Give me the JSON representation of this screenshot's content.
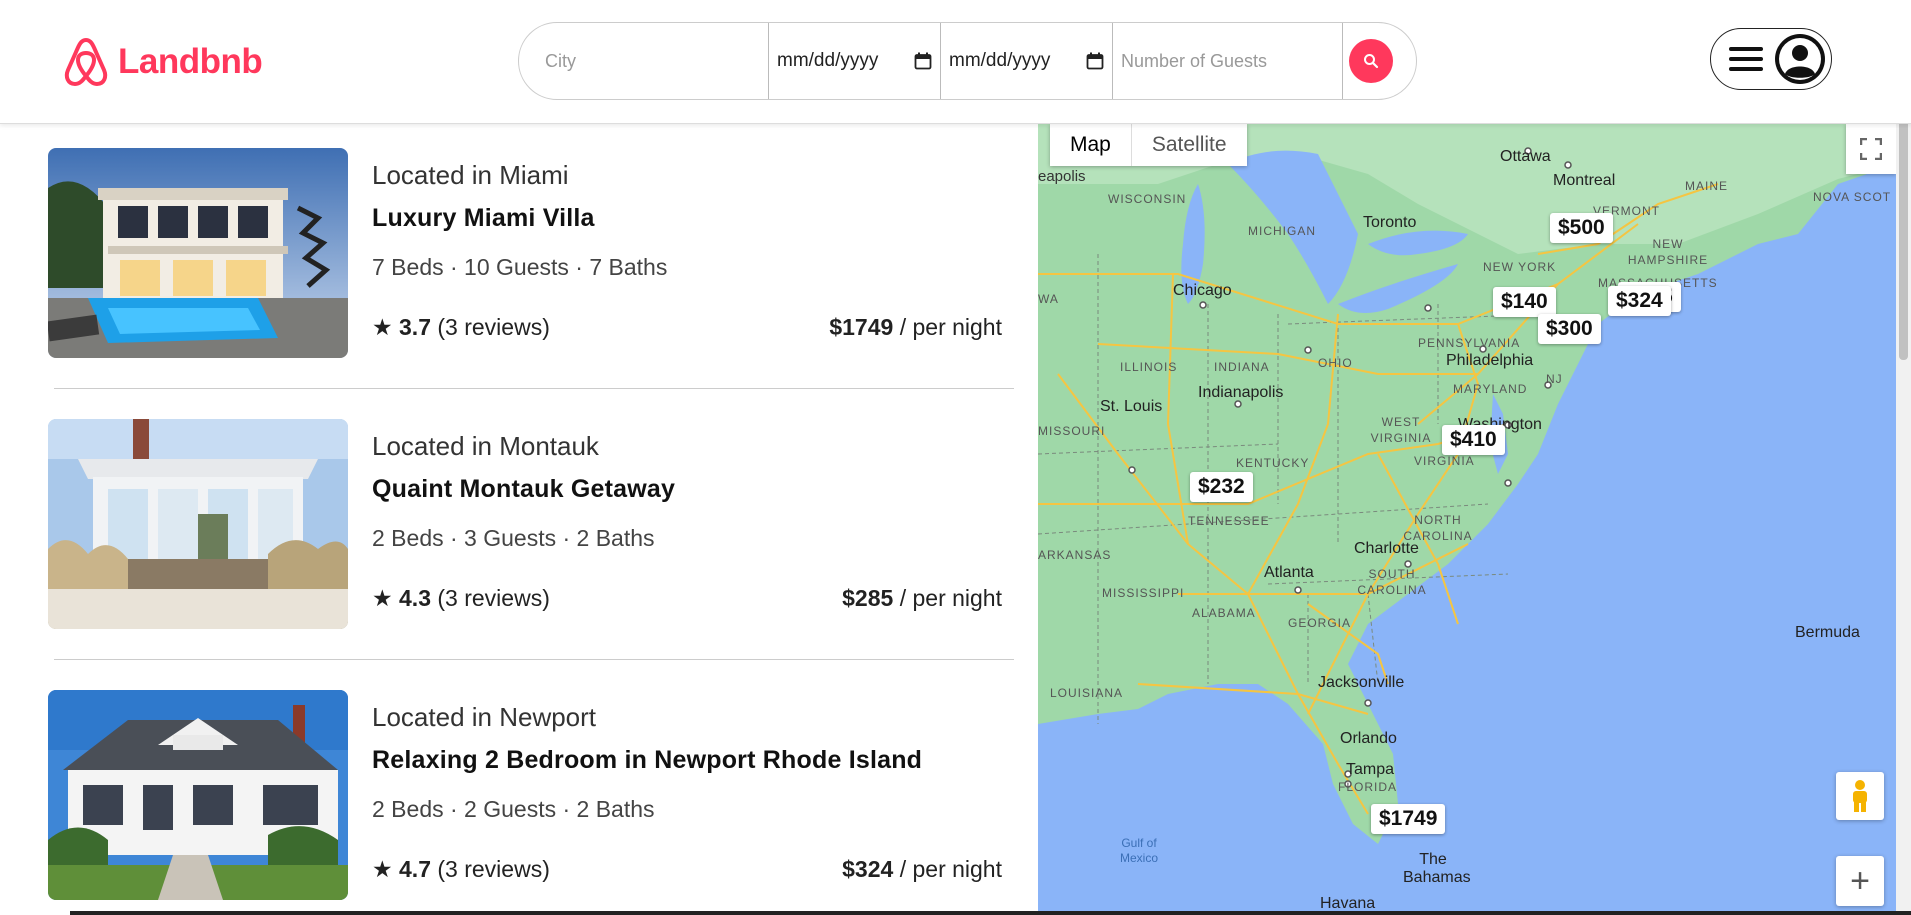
{
  "brand": {
    "name": "Landbnb",
    "color": "#ff385c"
  },
  "search": {
    "city_placeholder": "City",
    "checkin_placeholder": "mm/dd/yyyy",
    "checkout_placeholder": "mm/dd/yyyy",
    "guests_placeholder": "Number of Guests",
    "button_icon": "search-icon"
  },
  "user_menu": {
    "menu_icon": "hamburger-icon",
    "avatar_icon": "user-avatar-icon"
  },
  "listings": [
    {
      "location": "Located in Miami",
      "title": "Luxury Miami Villa",
      "details": "7 Beds · 10 Guests · 7 Baths",
      "rating": "3.7",
      "reviews": "(3 reviews)",
      "price": "$1749",
      "price_suffix": "/ per night"
    },
    {
      "location": "Located in Montauk",
      "title": "Quaint Montauk Getaway",
      "details": "2 Beds · 3 Guests · 2 Baths",
      "rating": "4.3",
      "reviews": "(3 reviews)",
      "price": "$285",
      "price_suffix": "/ per night"
    },
    {
      "location": "Located in Newport",
      "title": "Relaxing 2 Bedroom in Newport Rhode Island",
      "details": "2 Beds · 2 Guests · 2 Baths",
      "rating": "4.7",
      "reviews": "(3 reviews)",
      "price": "$324",
      "price_suffix": "/ per night"
    }
  ],
  "map": {
    "toggle": {
      "map": "Map",
      "satellite": "Satellite"
    },
    "pins": [
      "$500",
      "$140",
      "$324",
      "$285",
      "$300",
      "$410",
      "$232",
      "$1749"
    ],
    "labels": {
      "ottawa": "Ottawa",
      "montreal": "Montreal",
      "maine": "MAINE",
      "nova_scotia": "NOVA SCOT",
      "vermont": "VERMONT",
      "new_hampshire": "NEW HAMPSHIRE",
      "massachusetts": "MASSACHUSETTS",
      "toronto": "Toronto",
      "michigan": "MICHIGAN",
      "wisconsin": "WISCONSIN",
      "minneapolis": "eapolis",
      "new_york": "NEW YORK",
      "chicago": "Chicago",
      "iowa": "WA",
      "pennsylvania": "PENNSYLVANIA",
      "philadelphia": "Philadelphia",
      "illinois": "ILLINOIS",
      "indiana": "INDIANA",
      "ohio": "OHIO",
      "indianapolis": "Indianapolis",
      "maryland": "MARYLAND",
      "nj": "NJ",
      "st_louis": "St. Louis",
      "missouri": "MISSOURI",
      "west_virginia": "WEST VIRGINIA",
      "washington": "Washington",
      "virginia": "VIRGINIA",
      "kentucky": "KENTUCKY",
      "tennessee": "TENNESSEE",
      "north_carolina": "NORTH CAROLINA",
      "arkansas": "ARKANSAS",
      "charlotte": "Charlotte",
      "atlanta": "Atlanta",
      "south_carolina": "SOUTH CAROLINA",
      "mississippi": "MISSISSIPPI",
      "alabama": "ALABAMA",
      "georgia": "GEORGIA",
      "louisiana": "LOUISIANA",
      "jacksonville": "Jacksonville",
      "orlando": "Orlando",
      "tampa": "Tampa",
      "florida": "FLORIDA",
      "bermuda": "Bermuda",
      "gulf": "Gulf of Mexico",
      "bahamas": "The Bahamas",
      "havana": "Havana"
    },
    "colors": {
      "water": "#8ab4f8",
      "land": "#9fd8a8",
      "roads": "#f5c542"
    }
  }
}
